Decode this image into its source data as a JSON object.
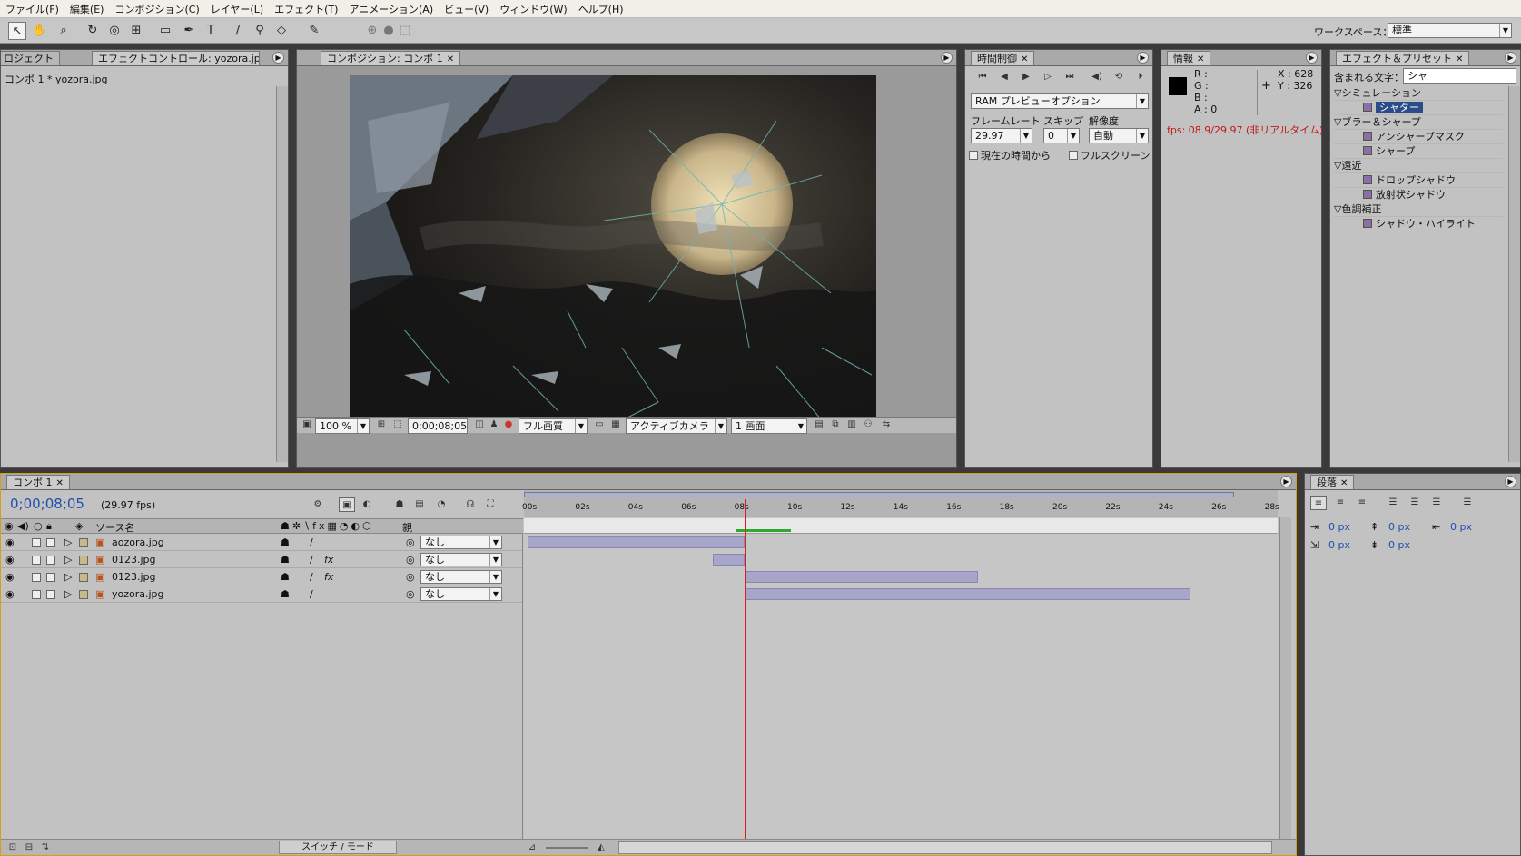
{
  "menu": [
    "ファイル(F)",
    "編集(E)",
    "コンポジション(C)",
    "レイヤー(L)",
    "エフェクト(T)",
    "アニメーション(A)",
    "ビュー(V)",
    "ウィンドウ(W)",
    "ヘルプ(H)"
  ],
  "workspace": {
    "label": "ワークスペース：",
    "value": "標準"
  },
  "project_panel": {
    "tab_project": "ロジェクト",
    "tab_effect": "エフェクトコントロール: yozora.jpg",
    "path": "コンポ 1 * yozora.jpg"
  },
  "comp_panel": {
    "tab": "コンポジション: コンポ 1",
    "zoom": "100 %",
    "timecode": "0;00;08;05",
    "quality": "フル画質",
    "camera": "アクティブカメラ",
    "views": "1 画面"
  },
  "time_panel": {
    "tab": "時間制御",
    "ram": "RAM プレビューオプション",
    "framerate_label": "フレームレート",
    "skip_label": "スキップ",
    "resolution_label": "解像度",
    "framerate": "29.97",
    "skip": "0",
    "resolution": "自動",
    "from_current": "現在の時間から",
    "fullscreen": "フルスクリーン"
  },
  "info_panel": {
    "tab": "情報",
    "r": "R :",
    "g": "G :",
    "b": "B :",
    "a": "A : 0",
    "x": "X : 628",
    "y": "Y : 326",
    "fps": "fps: 08.9/29.97 (非リアルタイム)"
  },
  "effects_panel": {
    "tab": "エフェクト＆プリセット",
    "contains_label": "含まれる文字：",
    "contains_value": "シャ",
    "items": [
      {
        "label": "シミュレーション",
        "type": "cat"
      },
      {
        "label": "シャター",
        "type": "fx",
        "selected": true
      },
      {
        "label": "ブラー＆シャープ",
        "type": "cat"
      },
      {
        "label": "アンシャープマスク",
        "type": "fx"
      },
      {
        "label": "シャープ",
        "type": "fx"
      },
      {
        "label": "遠近",
        "type": "cat"
      },
      {
        "label": "ドロップシャドウ",
        "type": "fx"
      },
      {
        "label": "放射状シャドウ",
        "type": "fx"
      },
      {
        "label": "色調補正",
        "type": "cat"
      },
      {
        "label": "シャドウ・ハイライト",
        "type": "fx"
      }
    ]
  },
  "timeline": {
    "tab": "コンポ 1",
    "timecode": "0;00;08;05",
    "fps": "(29.97 fps)",
    "source_header": "ソース名",
    "parent_header": "親",
    "switch_mode": "スイッチ / モード",
    "ruler": [
      "00s",
      "02s",
      "04s",
      "06s",
      "08s",
      "10s",
      "12s",
      "14s",
      "16s",
      "18s",
      "20s",
      "22s",
      "24s",
      "26s",
      "28s"
    ],
    "layers": [
      {
        "name": "aozora.jpg",
        "fx": false,
        "parent": "なし",
        "start": 0,
        "end": 8.2
      },
      {
        "name": "0123.jpg",
        "fx": true,
        "parent": "なし",
        "start": 7.0,
        "end": 8.2
      },
      {
        "name": "0123.jpg",
        "fx": true,
        "parent": "なし",
        "start": 8.2,
        "end": 17.0
      },
      {
        "name": "yozora.jpg",
        "fx": false,
        "parent": "なし",
        "start": 8.2,
        "end": 25.0
      }
    ],
    "current_time": 8.17
  },
  "paragraph_panel": {
    "tab": "段落",
    "v1": "0 px",
    "v2": "0 px",
    "v3": "0 px",
    "v4": "0 px",
    "v5": "0 px"
  }
}
